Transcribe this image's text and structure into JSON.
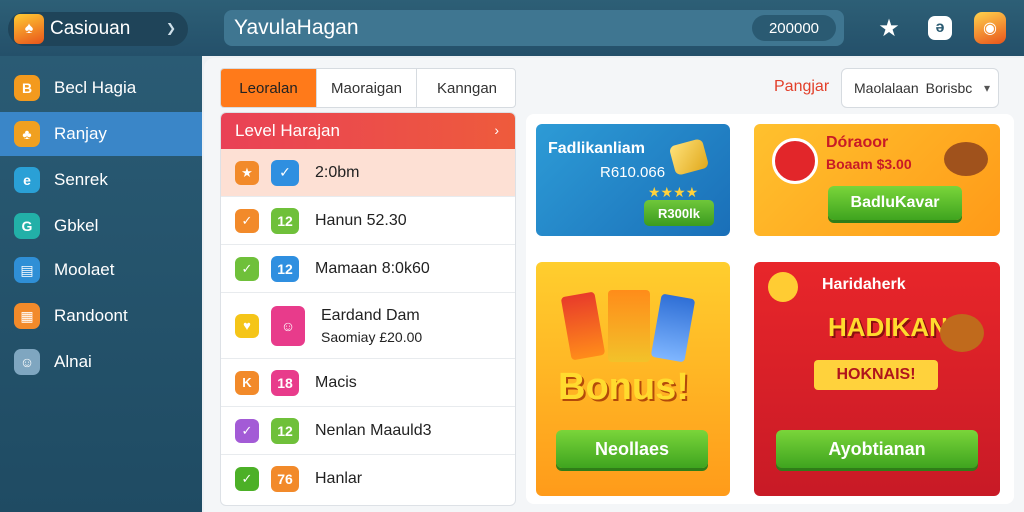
{
  "app": {
    "name": "Casiouan",
    "search_text": "YavulaHagan",
    "coins": "200000"
  },
  "colors": {
    "topbar": "#2d5f76",
    "sidebar": "#24506a",
    "accent": "#ff7a1a",
    "active": "#3a86c8",
    "level_header": "#e94156",
    "green": "#4cb027"
  },
  "sidebar": {
    "items": [
      {
        "label": "Becl Hagia",
        "icon": "bag-icon",
        "color": "#f39a1e"
      },
      {
        "label": "Ranjay",
        "icon": "game-icon",
        "color": "#f0a020",
        "active": true
      },
      {
        "label": "Senrek",
        "icon": "chat-icon",
        "color": "#2aa0d6"
      },
      {
        "label": "Gbkel",
        "icon": "globe-icon",
        "color": "#22b0a8"
      },
      {
        "label": "Moolaet",
        "icon": "card-icon",
        "color": "#2f8fd6"
      },
      {
        "label": "Randoont",
        "icon": "grid-icon",
        "color": "#f28a2a"
      },
      {
        "label": "Alnai",
        "icon": "mascot-icon",
        "color": "#7fa6c0"
      }
    ]
  },
  "tabs": [
    "Leoralan",
    "Maoraigan",
    "Kanngan"
  ],
  "filter": {
    "label": "Pangjar",
    "selected": "Maolalaan Borisbc"
  },
  "level": {
    "title": "Level Harajan",
    "rows": [
      {
        "label": "2:0bm",
        "badge_text": "★",
        "badge_color": "#f28a2a",
        "tile_text": "✓",
        "tile_color": "#2f8fe0"
      },
      {
        "label": "Hanun 52.30",
        "badge_text": "✓",
        "badge_color": "#f28a2a",
        "tile_text": "12",
        "tile_color": "#6fc03a"
      },
      {
        "label": "Mamaan 8:0k60",
        "badge_text": "✓",
        "badge_color": "#6fc03a",
        "tile_text": "12",
        "tile_color": "#2f8fe0"
      },
      {
        "label": "Eardand Dam",
        "sub": "Saomiay £20.00",
        "badge_text": "♥",
        "badge_color": "#f5c518",
        "tile_text": "☺",
        "tile_color": "#e83b8b"
      },
      {
        "label": "Macis",
        "badge_text": "K",
        "badge_color": "#f28a2a",
        "tile_text": "18",
        "tile_color": "#e83b8b"
      },
      {
        "label": "Nenlan Maauld3",
        "badge_text": "✓",
        "badge_color": "#a35bd6",
        "tile_text": "12",
        "tile_color": "#6fc03a"
      },
      {
        "label": "Hanlar",
        "badge_text": "✓",
        "badge_color": "#4cb027",
        "tile_text": "76",
        "tile_color": "#f28a2a"
      }
    ]
  },
  "promos": {
    "card1": {
      "title": "Fadlikanliam",
      "amount": "R610.066",
      "button": "R300lk"
    },
    "card2": {
      "title": "Dóraoor",
      "sub": "Boaam $3.00",
      "button": "BadluKavar"
    },
    "card3": {
      "title": "Bonus!",
      "button": "Neollaes"
    },
    "card4": {
      "title": "Haridaherk",
      "headline": "HADIKAN!",
      "banner": "HOKNAIS!",
      "button": "Ayobtianan"
    }
  }
}
